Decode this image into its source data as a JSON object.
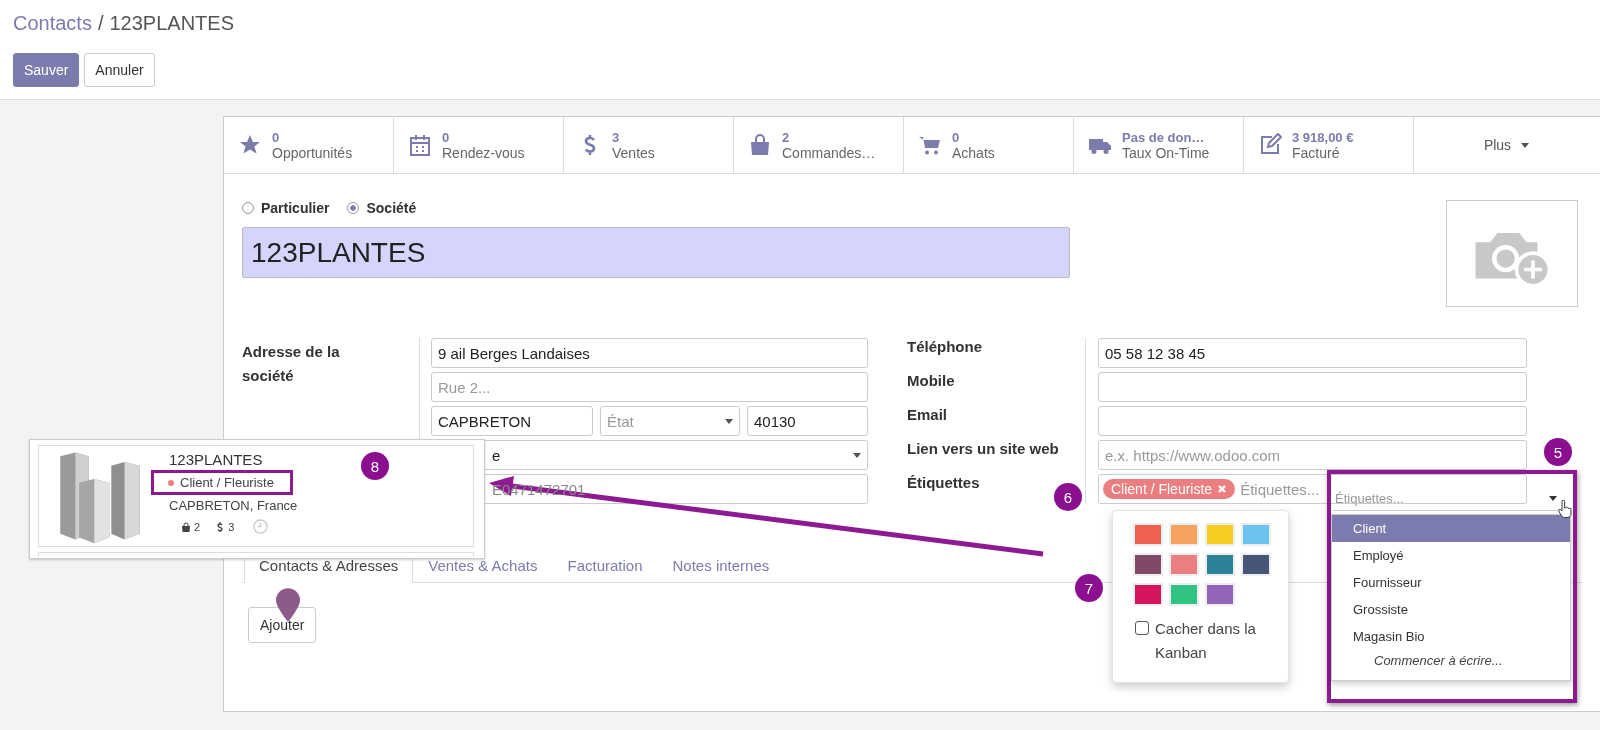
{
  "breadcrumb": {
    "parent": "Contacts",
    "separator": "/",
    "current": "123PLANTES"
  },
  "actions": [
    {
      "label": "Sauver",
      "primary": true
    },
    {
      "label": "Annuler",
      "primary": false
    }
  ],
  "stat_buttons": [
    {
      "value": "0",
      "label": "Opportunités"
    },
    {
      "value": "0",
      "label": "Rendez-vous"
    },
    {
      "value": "3",
      "label": "Ventes"
    },
    {
      "value": "2",
      "label": "Commandes…"
    },
    {
      "value": "0",
      "label": "Achats"
    },
    {
      "value": "Pas de don…",
      "label": "Taux On-Time"
    },
    {
      "value": "3 918,00 €",
      "label": "Facturé"
    }
  ],
  "more_button": "Plus",
  "company_type": [
    {
      "label": "Particulier",
      "selected": false
    },
    {
      "label": "Société",
      "selected": true
    }
  ],
  "name": "123PLANTES",
  "address": {
    "label": "Adresse de la société",
    "street": "9 ail Berges Landaises",
    "street2_placeholder": "Rue 2...",
    "city": "CAPBRETON",
    "state_placeholder": "État",
    "zip": "40130",
    "country": "e",
    "vat": "E0471472701"
  },
  "contact_fields": [
    {
      "label": "Téléphone",
      "kind": "text",
      "value": "05 58 12 38 45"
    },
    {
      "label": "Mobile",
      "kind": "text"
    },
    {
      "label": "Email",
      "kind": "text"
    },
    {
      "label": "Lien vers un site web",
      "kind": "text",
      "placeholder": "e.x. https://www.odoo.com"
    },
    {
      "label": "Étiquettes",
      "kind": "tags",
      "tags": [
        {
          "label": "Client / Fleuriste",
          "color": "#eb7e7f"
        }
      ],
      "placeholder": "Étiquettes..."
    }
  ],
  "tabs": [
    {
      "label": "Contacts & Adresses",
      "selected": true
    },
    {
      "label": "Ventes & Achats",
      "selected": false
    },
    {
      "label": "Facturation",
      "selected": false
    },
    {
      "label": "Notes internes",
      "selected": false
    }
  ],
  "add_button": "Ajouter",
  "kanban_card": {
    "name": "123PLANTES",
    "tag": {
      "label": "Client / Fleuriste",
      "color": "#eb7e7f"
    },
    "location": "CAPBRETON, France",
    "stats": [
      "2",
      "3"
    ]
  },
  "color_popover": {
    "colors": [
      {
        "color": "#f06050"
      },
      {
        "color": "#f4a460"
      },
      {
        "color": "#f7cd1f"
      },
      {
        "color": "#6cc1ed"
      },
      {
        "color": "#814968"
      },
      {
        "color": "#eb7e7f"
      },
      {
        "color": "#2c8397"
      },
      {
        "color": "#475577"
      },
      {
        "color": "#d6145f"
      },
      {
        "color": "#30c381"
      },
      {
        "color": "#9365b8"
      }
    ],
    "hide_checkbox": {
      "label": "Cacher dans la Kanban",
      "checked": false
    }
  },
  "tag_dropdown": {
    "placeholder": "Étiquettes...",
    "items": [
      {
        "label": "Client",
        "selected": true
      },
      {
        "label": "Employé",
        "selected": false
      },
      {
        "label": "Fournisseur",
        "selected": false
      },
      {
        "label": "Grossiste",
        "selected": false
      },
      {
        "label": "Magasin Bio",
        "selected": false
      }
    ],
    "hint": "Commencer à écrire..."
  },
  "annotations": [
    {
      "number": "8"
    },
    {
      "number": "6"
    },
    {
      "number": "5"
    },
    {
      "number": "7"
    }
  ]
}
